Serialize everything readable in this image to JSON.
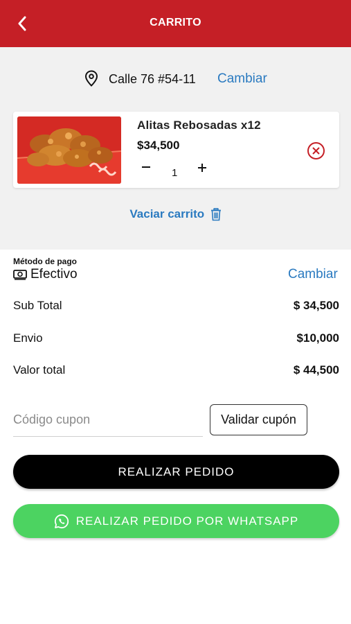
{
  "header": {
    "title": "CARRITO",
    "back_icon": "chevron-left-icon",
    "background_color": "#c51f26"
  },
  "address": {
    "icon": "location-pin-icon",
    "text": "Calle 76 #54-11",
    "change_label": "Cambiar"
  },
  "cart": {
    "items": [
      {
        "name": "Alitas Rebosadas x12",
        "price": "$34,500",
        "quantity": "1"
      }
    ],
    "empty_label": "Vaciar carrito",
    "empty_icon": "trash-icon"
  },
  "payment": {
    "label": "Método de pago",
    "icon": "cash-icon",
    "method": "Efectivo",
    "change_label": "Cambiar"
  },
  "summary": {
    "subtotal_label": "Sub Total",
    "subtotal_value": "$ 34,500",
    "shipping_label": "Envio",
    "shipping_value": "$10,000",
    "total_label": "Valor total",
    "total_value": "$ 44,500"
  },
  "coupon": {
    "placeholder": "Código cupon",
    "value": "",
    "validate_label": "Validar cupón"
  },
  "actions": {
    "order_label": "REALIZAR PEDIDO",
    "whatsapp_label": "REALIZAR PEDIDO POR WHATSAPP",
    "whatsapp_icon": "whatsapp-icon",
    "whatsapp_color": "#4cd361"
  },
  "colors": {
    "link": "#2a7ac0",
    "remove": "#c51f26"
  }
}
